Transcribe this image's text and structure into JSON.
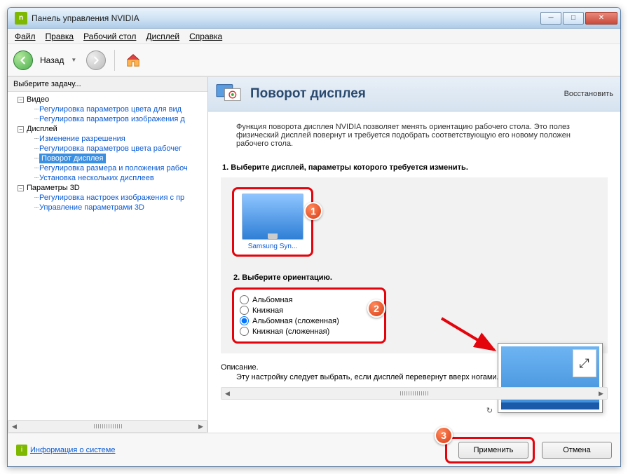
{
  "window": {
    "title": "Панель управления NVIDIA"
  },
  "menu": {
    "file": "Файл",
    "edit": "Правка",
    "desktop": "Рабочий стол",
    "display": "Дисплей",
    "help": "Справка"
  },
  "toolbar": {
    "back": "Назад"
  },
  "sidebar": {
    "task_header": "Выберите задачу...",
    "groups": {
      "video": "Видео",
      "video_items": [
        "Регулировка параметров цвета для вид",
        "Регулировка параметров изображения д"
      ],
      "display": "Дисплей",
      "display_items": [
        "Изменение разрешения",
        "Регулировка параметров цвета рабочег",
        "Поворот дисплея",
        "Регулировка размера и положения рабоч",
        "Установка нескольких дисплеев"
      ],
      "d3d": "Параметры 3D",
      "d3d_items": [
        "Регулировка настроек изображения с пр",
        "Управление параметрами 3D"
      ]
    },
    "selected": "Поворот дисплея"
  },
  "header": {
    "title": "Поворот дисплея",
    "restore": "Восстановить"
  },
  "content": {
    "intro": "Функция поворота дисплея NVIDIA позволяет менять ориентацию рабочего стола. Это полез\nфизический дисплей повернут и требуется подобрать соответствующую его новому положен\nрабочего стола.",
    "step1": "1. Выберите дисплей, параметры которого требуется изменить.",
    "display_name": "Samsung Syn...",
    "step2": "2. Выберите ориентацию.",
    "orientations": {
      "landscape": "Альбомная",
      "portrait": "Книжная",
      "landscape_flipped": "Альбомная (сложенная)",
      "portrait_flipped": "Книжная (сложенная)"
    },
    "selected_orientation": "landscape_flipped",
    "desc_label": "Описание.",
    "desc_text": "Эту настройку следует выбрать, если дисплей перевернут вверх ногами."
  },
  "footer": {
    "sysinfo": "Информация о системе",
    "apply": "Применить",
    "cancel": "Отмена"
  },
  "annotations": {
    "b1": "1",
    "b2": "2",
    "b3": "3"
  }
}
